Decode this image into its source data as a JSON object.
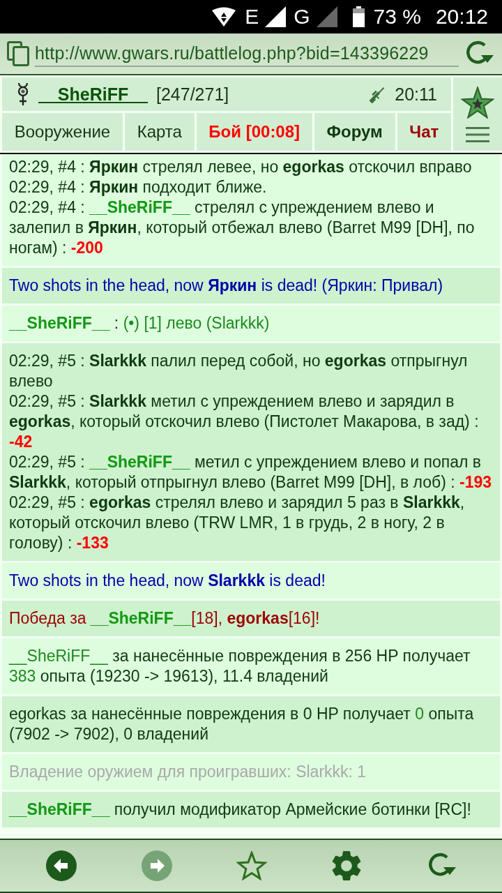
{
  "status_bar": {
    "networks": [
      {
        "label": "E",
        "active": true
      },
      {
        "label": "G",
        "active": false
      }
    ],
    "battery": "73 %",
    "time": "20:12"
  },
  "address_bar": {
    "url": "http://www.gwars.ru/battlelog.php?bid=143396229"
  },
  "header": {
    "player": "__SheRiFF__",
    "hp": "[247/271]",
    "time": "20:11",
    "tabs": [
      {
        "label": "Вооружение",
        "kind": "plain"
      },
      {
        "label": "Карта",
        "kind": "plain"
      },
      {
        "label": "Бой [00:08]",
        "kind": "alert"
      },
      {
        "label": "Форум",
        "kind": "strong"
      },
      {
        "label": "Чат",
        "kind": "accent"
      }
    ]
  },
  "log": [
    {
      "kind": "action",
      "lines": [
        [
          {
            "text": "02:29, #4 : ",
            "kind": "plain"
          },
          {
            "text": "Яркин",
            "kind": "name"
          },
          {
            "text": " стрелял левее, но ",
            "kind": "plain"
          },
          {
            "text": "egorkas",
            "kind": "name"
          },
          {
            "text": " отскочил вправо",
            "kind": "plain"
          }
        ],
        [
          {
            "text": "02:29, #4 : ",
            "kind": "plain"
          },
          {
            "text": "Яркин",
            "kind": "name"
          },
          {
            "text": " подходит ближе.",
            "kind": "plain"
          }
        ],
        [
          {
            "text": "02:29, #4 : ",
            "kind": "plain"
          },
          {
            "text": "__SheRiFF__",
            "kind": "self"
          },
          {
            "text": " стрелял с упреждением влево и залепил в ",
            "kind": "plain"
          },
          {
            "text": "Яркин",
            "kind": "name"
          },
          {
            "text": ", который отбежал влево (Barret M99 [DH], по ногам) : ",
            "kind": "plain"
          },
          {
            "text": "-200",
            "kind": "damage"
          }
        ]
      ]
    },
    {
      "kind": "death",
      "lines": [
        [
          {
            "text": "Two shots in the head, now ",
            "kind": "plain"
          },
          {
            "text": "Яркин",
            "kind": "name"
          },
          {
            "text": " is dead! (Яркин: Привал)",
            "kind": "plain"
          }
        ]
      ]
    },
    {
      "kind": "action",
      "lines": [
        [
          {
            "text": "__SheRiFF__",
            "kind": "self"
          },
          {
            "text": " : ",
            "kind": "plain"
          },
          {
            "text": "(•) [1] лево (Slarkkk)",
            "kind": "green"
          }
        ]
      ]
    },
    {
      "kind": "action",
      "lines": [
        [
          {
            "text": "02:29, #5 : ",
            "kind": "plain"
          },
          {
            "text": "Slarkkk",
            "kind": "name"
          },
          {
            "text": " палил перед собой, но ",
            "kind": "plain"
          },
          {
            "text": "egorkas",
            "kind": "name"
          },
          {
            "text": " отпрыгнул влево",
            "kind": "plain"
          }
        ],
        [
          {
            "text": "02:29, #5 : ",
            "kind": "plain"
          },
          {
            "text": "Slarkkk",
            "kind": "name"
          },
          {
            "text": " метил с упреждением влево и зарядил в ",
            "kind": "plain"
          },
          {
            "text": "egorkas",
            "kind": "name"
          },
          {
            "text": ", который отскочил влево (Пистолет Макарова, в зад) : ",
            "kind": "plain"
          },
          {
            "text": "-42",
            "kind": "damage"
          }
        ],
        [
          {
            "text": "02:29, #5 : ",
            "kind": "plain"
          },
          {
            "text": "__SheRiFF__",
            "kind": "self"
          },
          {
            "text": " метил с упреждением влево и попал в ",
            "kind": "plain"
          },
          {
            "text": "Slarkkk",
            "kind": "name"
          },
          {
            "text": ", который отпрыгнул влево (Barret M99 [DH], в лоб) : ",
            "kind": "plain"
          },
          {
            "text": "-193",
            "kind": "damage"
          }
        ],
        [
          {
            "text": "02:29, #5 : ",
            "kind": "plain"
          },
          {
            "text": "egorkas",
            "kind": "name"
          },
          {
            "text": " стрелял влево и зарядил 5 раз в ",
            "kind": "plain"
          },
          {
            "text": "Slarkkk",
            "kind": "name"
          },
          {
            "text": ", который отскочил влево (TRW LMR, 1 в грудь, 2 в ногу, 2 в голову) : ",
            "kind": "plain"
          },
          {
            "text": "-133",
            "kind": "damage"
          }
        ]
      ]
    },
    {
      "kind": "death",
      "lines": [
        [
          {
            "text": "Two shots in the head, now ",
            "kind": "plain"
          },
          {
            "text": "Slarkkk",
            "kind": "name"
          },
          {
            "text": " is dead!",
            "kind": "plain"
          }
        ]
      ]
    },
    {
      "kind": "victory",
      "lines": [
        [
          {
            "text": "Победа за ",
            "kind": "plain"
          },
          {
            "text": "__SheRiFF__",
            "kind": "self"
          },
          {
            "text": "[18], ",
            "kind": "plain"
          },
          {
            "text": "egorkas",
            "kind": "name"
          },
          {
            "text": "[16]!",
            "kind": "plain"
          }
        ]
      ]
    },
    {
      "kind": "info",
      "lines": [
        [
          {
            "text": "__SheRiFF__",
            "kind": "green"
          },
          {
            "text": " за нанесённые повреждения в 256 HP получает ",
            "kind": "plain"
          },
          {
            "text": "383",
            "kind": "green"
          },
          {
            "text": " опыта (19230 -> 19613), 11.4 владений",
            "kind": "plain"
          }
        ]
      ]
    },
    {
      "kind": "info",
      "lines": [
        [
          {
            "text": "egorkas за нанесённые повреждения в 0 HP получает ",
            "kind": "plain"
          },
          {
            "text": "0",
            "kind": "green"
          },
          {
            "text": " опыта (7902 -> 7902), 0 владений",
            "kind": "plain"
          }
        ]
      ]
    },
    {
      "kind": "muted",
      "lines": [
        [
          {
            "text": "Владение оружием для проигравших: Slarkkk: 1",
            "kind": "plain"
          }
        ]
      ]
    },
    {
      "kind": "info",
      "lines": [
        [
          {
            "text": "__SheRiFF__",
            "kind": "self"
          },
          {
            "text": " получил модификатор Армейские ботинки [RC]!",
            "kind": "plain"
          }
        ]
      ]
    }
  ],
  "bottom_bar": {
    "buttons": [
      {
        "kind": "back",
        "disabled": false
      },
      {
        "kind": "forward",
        "disabled": true
      },
      {
        "kind": "bookmark",
        "disabled": false
      },
      {
        "kind": "settings",
        "disabled": false
      },
      {
        "kind": "reload",
        "disabled": false
      }
    ]
  }
}
